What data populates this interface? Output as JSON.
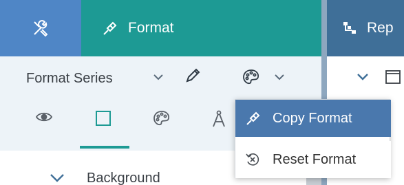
{
  "colors": {
    "tool_tab": "#4f86c6",
    "format_tab": "#1d9a94",
    "report_tab": "#3f6f98",
    "panel_bg": "#edf3f8",
    "menu_highlight": "#4a78ad",
    "tab_underline": "#1d9a94"
  },
  "header": {
    "tool_icon": "tools-icon",
    "format_label": "Format",
    "format_icon": "paint-brush-icon",
    "report_label": "Rep",
    "report_icon": "hierarchy-icon"
  },
  "panel": {
    "series_selector": "Format Series",
    "series_chevron_icon": "chevron-down-icon",
    "edit_icon": "pencil-icon",
    "palette_icon": "palette-icon",
    "icon_tabs": [
      {
        "icon": "eye-icon",
        "active": false
      },
      {
        "icon": "square-icon",
        "active": true
      },
      {
        "icon": "palette-icon",
        "active": false
      },
      {
        "icon": "compass-icon",
        "active": false
      }
    ],
    "section_label": "Background",
    "section_chevron_icon": "chevron-down-icon"
  },
  "right_panel": {
    "chevron_icon": "chevron-down-icon",
    "window_icon": "window-icon"
  },
  "menu": {
    "items": [
      {
        "label": "Copy Format",
        "icon": "paint-brush-icon",
        "highlighted": true
      },
      {
        "label": "Reset Format",
        "icon": "reset-icon",
        "highlighted": false
      }
    ]
  }
}
